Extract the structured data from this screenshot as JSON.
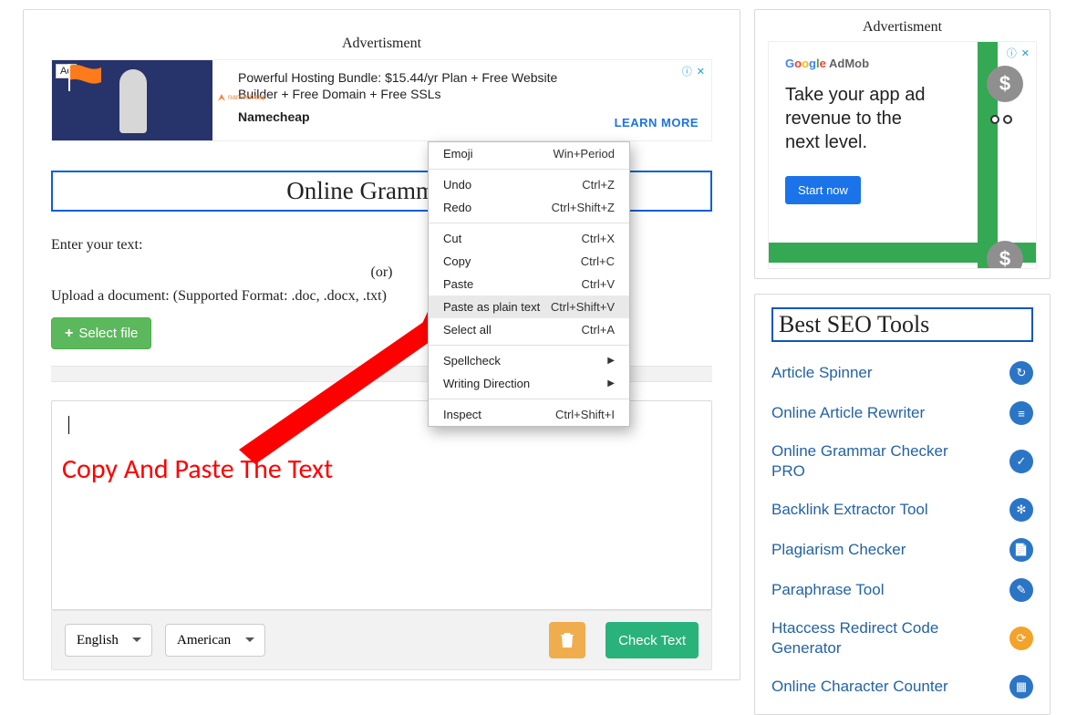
{
  "left": {
    "ad_label": "Advertisment",
    "ad_tag": "Ad",
    "ad_title": "Powerful Hosting Bundle: $15.44/yr Plan + Free Website Builder + Free Domain + Free SSLs",
    "ad_sub": "Namecheap",
    "ad_cta": "LEARN MORE",
    "page_title": "Online Grammar C",
    "enter_text": "Enter your text:",
    "or_text": "(or)",
    "upload_text": "Upload a document: (Supported Format: .doc, .docx, .txt)",
    "select_file": "Select file",
    "lang_select": "English",
    "variant_select": "American",
    "check_button": "Check Text",
    "annotation": "Copy And Paste The Text"
  },
  "ctx": {
    "items": [
      {
        "label": "Emoji",
        "shortcut": "Win+Period",
        "type": "item"
      },
      {
        "type": "sep"
      },
      {
        "label": "Undo",
        "shortcut": "Ctrl+Z",
        "type": "item"
      },
      {
        "label": "Redo",
        "shortcut": "Ctrl+Shift+Z",
        "type": "item"
      },
      {
        "type": "sep"
      },
      {
        "label": "Cut",
        "shortcut": "Ctrl+X",
        "type": "item"
      },
      {
        "label": "Copy",
        "shortcut": "Ctrl+C",
        "type": "item"
      },
      {
        "label": "Paste",
        "shortcut": "Ctrl+V",
        "type": "item"
      },
      {
        "label": "Paste as plain text",
        "shortcut": "Ctrl+Shift+V",
        "type": "item",
        "highlight": true
      },
      {
        "label": "Select all",
        "shortcut": "Ctrl+A",
        "type": "item"
      },
      {
        "type": "sep"
      },
      {
        "label": "Spellcheck",
        "shortcut": "",
        "type": "sub"
      },
      {
        "label": "Writing Direction",
        "shortcut": "",
        "type": "sub"
      },
      {
        "type": "sep"
      },
      {
        "label": "Inspect",
        "shortcut": "Ctrl+Shift+I",
        "type": "item"
      }
    ]
  },
  "right": {
    "ad_label": "Advertisment",
    "admob_brand": "Google AdMob",
    "admob_headline": "Take your app ad revenue to the next level.",
    "admob_cta": "Start now",
    "tools_title": "Best SEO Tools",
    "tools": [
      {
        "label": "Article Spinner",
        "icon": "↻",
        "bg": "#2b75c6"
      },
      {
        "label": "Online Article Rewriter",
        "icon": "≡",
        "bg": "#2b75c6"
      },
      {
        "label": "Online Grammar Checker PRO",
        "icon": "✓",
        "bg": "#2b75c6"
      },
      {
        "label": "Backlink Extractor Tool",
        "icon": "✻",
        "bg": "#2b75c6"
      },
      {
        "label": "Plagiarism Checker",
        "icon": "📄",
        "bg": "#2b75c6"
      },
      {
        "label": "Paraphrase Tool",
        "icon": "✎",
        "bg": "#2b75c6"
      },
      {
        "label": "Htaccess Redirect Code Generator",
        "icon": "⟳",
        "bg": "#f3a22a"
      },
      {
        "label": "Online Character Counter",
        "icon": "▦",
        "bg": "#2b75c6"
      }
    ]
  }
}
